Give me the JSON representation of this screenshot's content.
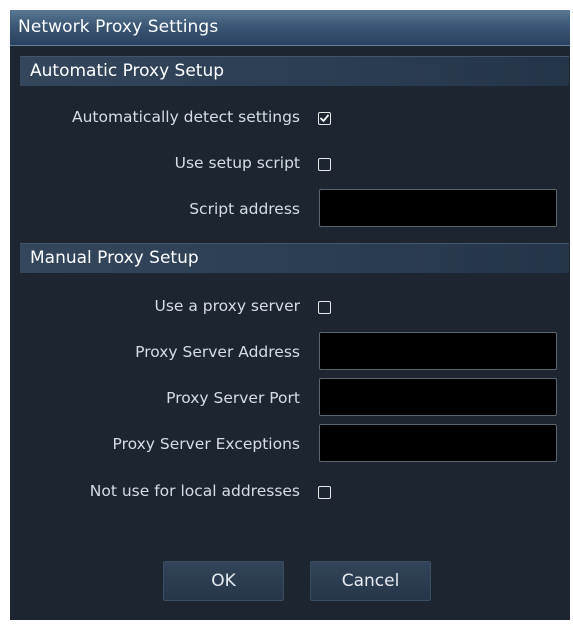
{
  "window": {
    "title": "Network Proxy Settings"
  },
  "automatic": {
    "header": "Automatic Proxy Setup",
    "detect_label": "Automatically detect settings",
    "detect_checked": true,
    "script_label": "Use setup script",
    "script_checked": false,
    "address_label": "Script address",
    "address_value": ""
  },
  "manual": {
    "header": "Manual Proxy Setup",
    "use_proxy_label": "Use a proxy server",
    "use_proxy_checked": false,
    "server_address_label": "Proxy Server Address",
    "server_address_value": "",
    "server_port_label": "Proxy Server Port",
    "server_port_value": "",
    "exceptions_label": "Proxy Server Exceptions",
    "exceptions_value": "",
    "local_label": "Not use for local addresses",
    "local_checked": false
  },
  "buttons": {
    "ok": "OK",
    "cancel": "Cancel"
  },
  "colors": {
    "window_bg": "#1c2530",
    "titlebar": "#3b5775",
    "section_header": "#2b3d52",
    "field_bg": "#000000",
    "label_text": "#d6dde4"
  }
}
